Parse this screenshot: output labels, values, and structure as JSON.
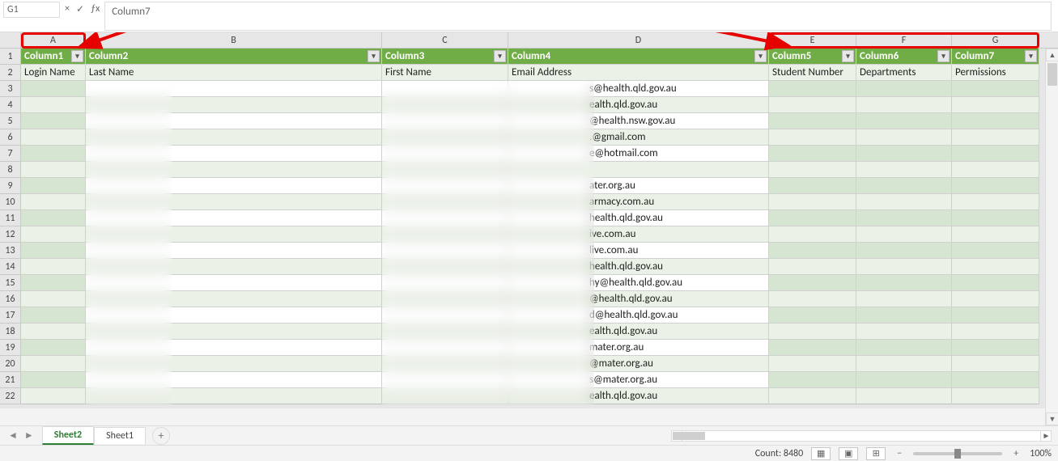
{
  "formula_bar": {
    "name_box": "G1",
    "formula_value": "Column7"
  },
  "columns": [
    "A",
    "B",
    "C",
    "D",
    "E",
    "F",
    "G"
  ],
  "header_row": {
    "A": "Column1",
    "B": "Column2",
    "C": "Column3",
    "D": "Column4",
    "E": "Column5",
    "F": "Column6",
    "G": "Column7"
  },
  "sub_header": {
    "A": "Login Name",
    "B": "Last Name",
    "C": "First Name",
    "D": "Email Address",
    "E": "Student Number",
    "F": "Departments",
    "G": "Permissions"
  },
  "emails": [
    "s@health.qld.gov.au",
    "ealth.qld.gov.au",
    "@health.nsw.gov.au",
    ".@gmail.com",
    "e@hotmail.com",
    "",
    "ater.org.au",
    "armacy.com.au",
    "health.qld.gov.au",
    "ive.com.au",
    "live.com.au",
    "health.qld.gov.au",
    "hy@health.qld.gov.au",
    "@health.qld.gov.au",
    "d@health.qld.gov.au",
    "ealth.qld.gov.au",
    "mater.org.au",
    "@mater.org.au",
    "s@mater.org.au",
    "ealth.qld.gov.au"
  ],
  "tabs": {
    "active": "Sheet2",
    "other": "Sheet1"
  },
  "status": {
    "count_label": "Count: 8480",
    "zoom_label": "100%"
  }
}
